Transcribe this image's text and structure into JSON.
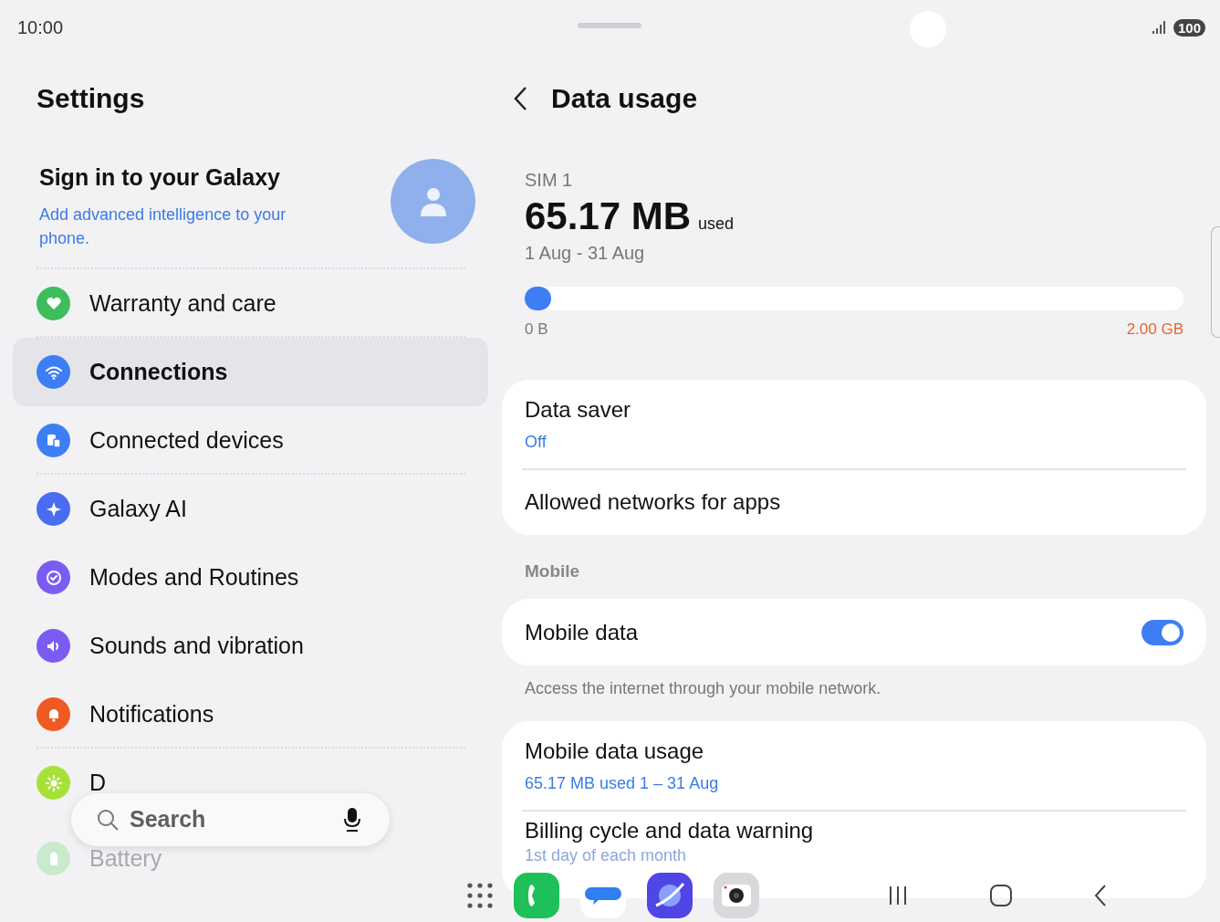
{
  "status_bar": {
    "time": "10:00",
    "battery": "100"
  },
  "settings": {
    "title": "Settings",
    "account": {
      "title": "Sign in to your Galaxy",
      "subtitle": "Add advanced intelligence to your phone."
    },
    "items": [
      {
        "label": "Warranty and care",
        "selected": false,
        "color": "#3dbd5c",
        "group_end": true,
        "faded": false
      },
      {
        "label": "Connections",
        "selected": true,
        "color": "#3d7ef5",
        "group_end": false,
        "faded": false
      },
      {
        "label": "Connected devices",
        "selected": false,
        "color": "#3d7ef5",
        "group_end": true,
        "faded": false
      },
      {
        "label": "Galaxy AI",
        "selected": false,
        "color": "#4a6cf0",
        "group_end": false,
        "faded": false
      },
      {
        "label": "Modes and Routines",
        "selected": false,
        "color": "#7b5cf2",
        "group_end": false,
        "faded": false
      },
      {
        "label": "Sounds and vibration",
        "selected": false,
        "color": "#7b5cf2",
        "group_end": false,
        "faded": false
      },
      {
        "label": "Notifications",
        "selected": false,
        "color": "#f05a22",
        "group_end": true,
        "faded": false
      },
      {
        "label": "D",
        "selected": false,
        "color": "#a8e03a",
        "group_end": false,
        "faded": false
      },
      {
        "label": "Battery",
        "selected": false,
        "color": "#c9eacd",
        "group_end": false,
        "faded": true
      }
    ]
  },
  "search": {
    "placeholder": "Search"
  },
  "detail": {
    "title": "Data usage",
    "usage": {
      "sim": "SIM 1",
      "amount": "65.17 MB",
      "unit": "used",
      "period": "1 Aug - 31 Aug",
      "level": 0.04,
      "min_label": "0 B",
      "max_label": "2.00 GB"
    },
    "sections": [
      {
        "kind": "card",
        "items": [
          {
            "title": "Data saver",
            "subtitle": "Off"
          },
          {
            "title": "Allowed networks for apps"
          }
        ]
      },
      {
        "kind": "header",
        "text": "Mobile"
      },
      {
        "kind": "card",
        "items": [
          {
            "title": "Mobile data",
            "on": true
          }
        ]
      },
      {
        "kind": "caption",
        "text": "Access the internet through your mobile network."
      },
      {
        "kind": "card",
        "items": [
          {
            "title": "Mobile data usage",
            "subtitle": "65.17 MB used 1 – 31 Aug"
          },
          {
            "title": "Billing cycle and data warning",
            "subtitle": "1st day of each month",
            "faded": true
          }
        ]
      }
    ]
  }
}
